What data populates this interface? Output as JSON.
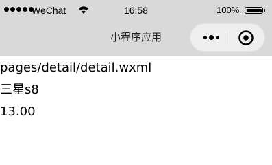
{
  "status_bar": {
    "carrier": "WeChat",
    "signal_icon": "signal-dots-icon",
    "wifi_icon": "wifi-icon",
    "time": "16:58",
    "battery_percent": "100%",
    "battery_icon": "battery-icon",
    "battery_level": 1.0
  },
  "nav_bar": {
    "title": "小程序应用",
    "background": "#d9d9d9",
    "capsule": {
      "menu_icon": "more-dots-icon",
      "close_icon": "target-close-icon"
    }
  },
  "page": {
    "path_text": "pages/detail/detail.wxml",
    "product_name": "三星s8",
    "price": "13.00"
  }
}
